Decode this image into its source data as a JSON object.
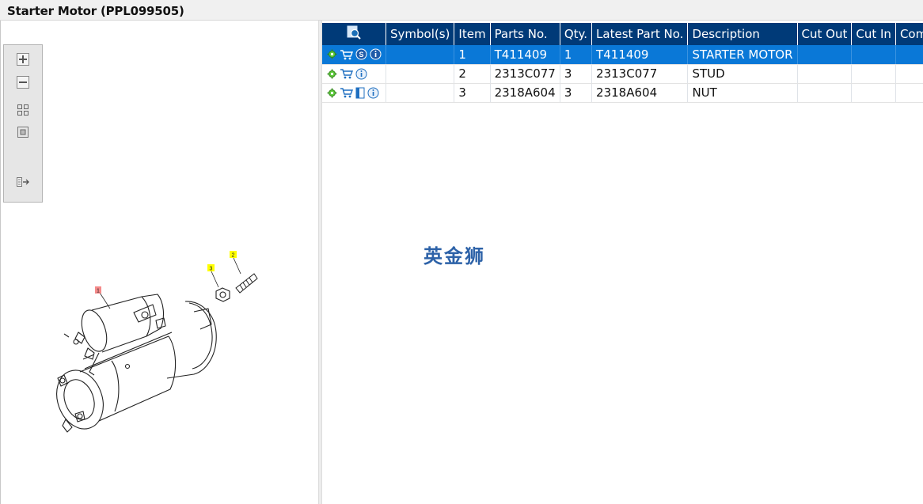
{
  "window": {
    "title": "Starter Motor (PPL099505)"
  },
  "toolbox": {
    "tools": [
      "zoom-in-icon",
      "zoom-out-icon",
      "fit-all-icon",
      "fit-window-icon",
      "export-icon"
    ]
  },
  "drawing": {
    "callouts": [
      {
        "label": "1",
        "color": "#f58a8a"
      },
      {
        "label": "2",
        "color": "#ffff00"
      },
      {
        "label": "3",
        "color": "#ffff00"
      }
    ]
  },
  "table": {
    "headers": {
      "find": "",
      "symbols": "Symbol(s)",
      "item": "Item",
      "parts_no": "Parts No.",
      "qty": "Qty.",
      "latest_part_no": "Latest Part No.",
      "description": "Description",
      "cut_out": "Cut Out",
      "cut_in": "Cut In",
      "comment": "Comment"
    },
    "rows": [
      {
        "icons": [
          "gear-icon",
          "cart-icon",
          "s-badge-icon",
          "info-icon"
        ],
        "symbols": "",
        "item": "1",
        "parts_no": "T411409",
        "qty": "1",
        "latest_part_no": "T411409",
        "description": "STARTER MOTOR",
        "cut_out": "",
        "cut_in": "",
        "comment": "",
        "selected": true
      },
      {
        "icons": [
          "gear-icon",
          "cart-icon",
          "info-icon"
        ],
        "symbols": "",
        "item": "2",
        "parts_no": "2313C077",
        "qty": "3",
        "latest_part_no": "2313C077",
        "description": "STUD",
        "cut_out": "",
        "cut_in": "",
        "comment": "",
        "selected": false
      },
      {
        "icons": [
          "gear-icon",
          "cart-icon",
          "book-icon",
          "info-icon"
        ],
        "symbols": "",
        "item": "3",
        "parts_no": "2318A604",
        "qty": "3",
        "latest_part_no": "2318A604",
        "description": "NUT",
        "cut_out": "",
        "cut_in": "",
        "comment": "",
        "selected": false
      }
    ]
  },
  "watermark": {
    "text": "英金狮"
  },
  "colors": {
    "header_bg": "#003a78",
    "selected_row": "#0a78d7",
    "gear": "#4caf20",
    "icon_blue": "#1f6fc0"
  }
}
